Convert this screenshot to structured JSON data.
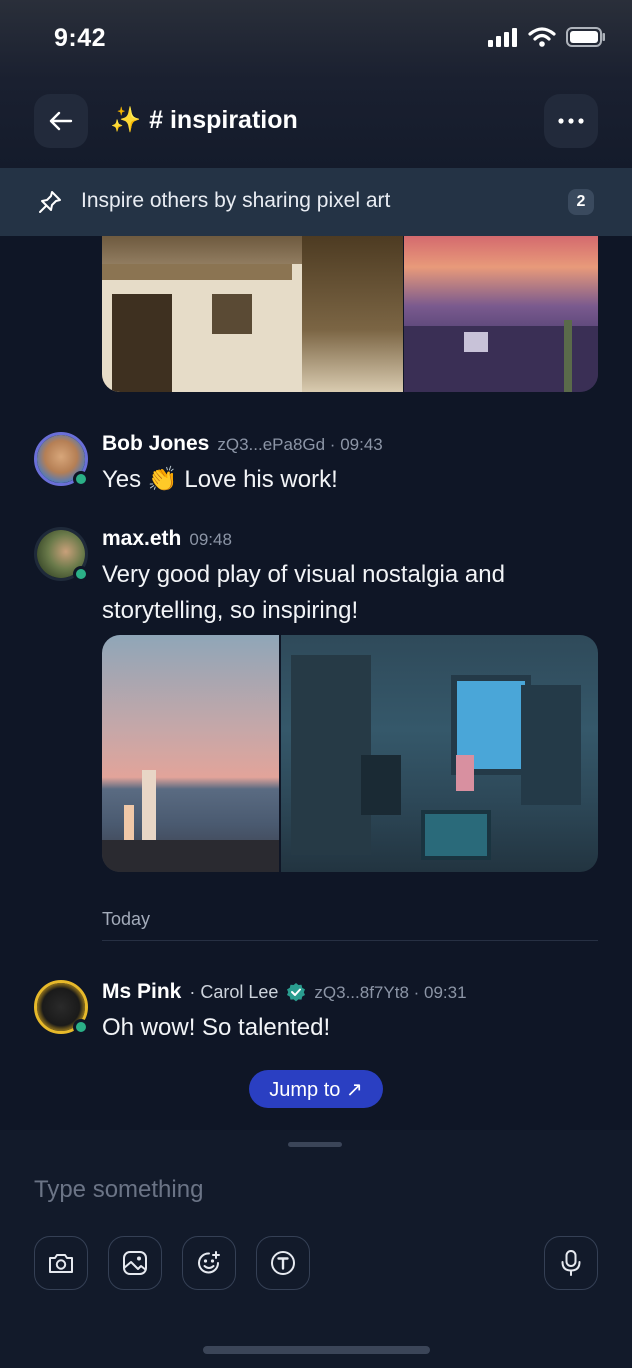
{
  "status": {
    "time": "9:42"
  },
  "channel": {
    "emoji": "✨",
    "title": "# inspiration"
  },
  "pinned": {
    "text": "Inspire others by sharing pixel art",
    "count": "2"
  },
  "messages": [
    {
      "name": "Bob Jones",
      "meta": "zQ3...ePa8Gd · 09:43",
      "text": "Yes 👏 Love his work!"
    },
    {
      "name": "max.eth",
      "meta": "09:48",
      "text": "Very good play of visual nostalgia and storytelling, so inspiring!"
    },
    {
      "name": "Ms Pink",
      "alt_name": "· Carol Lee",
      "meta": "zQ3...8f7Yt8 · 09:31",
      "text": "Oh wow! So talented!"
    }
  ],
  "date_separator": "Today",
  "jump_button": "Jump to ↗",
  "composer": {
    "placeholder": "Type something"
  },
  "colors": {
    "background": "#0f1626",
    "accent": "#2a3fc2",
    "online": "#2bb087",
    "verified": "#2a9d8f"
  },
  "icons": [
    "back-arrow-icon",
    "more-icon",
    "pin-icon",
    "camera-icon",
    "image-icon",
    "emoji-icon",
    "text-format-icon",
    "microphone-icon",
    "verified-icon"
  ]
}
